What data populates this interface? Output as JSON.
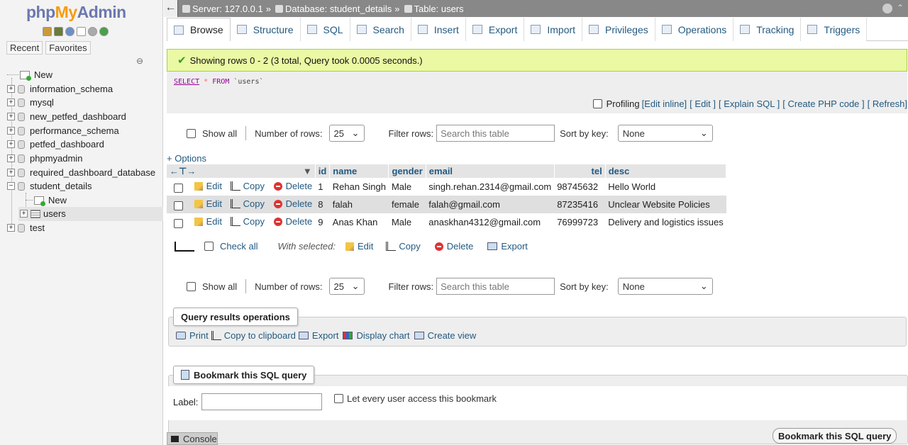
{
  "sidebar": {
    "logo_php": "php",
    "logo_my": "My",
    "logo_admin": "Admin",
    "tabs": [
      "Recent",
      "Favorites"
    ],
    "tree": {
      "new_label": "New",
      "databases": [
        {
          "name": "information_schema"
        },
        {
          "name": "mysql"
        },
        {
          "name": "new_petfed_dashboard"
        },
        {
          "name": "performance_schema"
        },
        {
          "name": "petfed_dashboard"
        },
        {
          "name": "phpmyadmin"
        },
        {
          "name": "required_dashboard_database"
        },
        {
          "name": "student_details"
        },
        {
          "name": "test"
        }
      ],
      "child_new": "New",
      "child_table": "users"
    }
  },
  "breadcrumb": {
    "server": "Server: 127.0.0.1",
    "database": "Database: student_details",
    "table": "Table: users",
    "sep": "»"
  },
  "tabs": [
    "Browse",
    "Structure",
    "SQL",
    "Search",
    "Insert",
    "Export",
    "Import",
    "Privileges",
    "Operations",
    "Tracking",
    "Triggers"
  ],
  "message": "Showing rows 0 - 2 (3 total, Query took 0.0005 seconds.)",
  "sql": {
    "select": "SELECT",
    "star": "*",
    "from": "FROM",
    "table": "`users`"
  },
  "profiling": {
    "label": "Profiling",
    "edit_inline": "[Edit inline]",
    "edit": "[ Edit ]",
    "explain": "[ Explain SQL ]",
    "php": "[ Create PHP code ]",
    "refresh": "[ Refresh]"
  },
  "nav": {
    "show_all": "Show all",
    "num_rows_label": "Number of rows:",
    "num_rows_value": "25",
    "filter_label": "Filter rows:",
    "filter_placeholder": "Search this table",
    "sort_label": "Sort by key:",
    "sort_value": "None"
  },
  "options_link": "+ Options",
  "table": {
    "columns": [
      "id",
      "name",
      "gender",
      "email",
      "tel",
      "desc"
    ],
    "actions": {
      "edit": "Edit",
      "copy": "Copy",
      "delete": "Delete"
    },
    "rows": [
      {
        "id": "1",
        "name": "Rehan Singh",
        "gender": "Male",
        "email": "singh.rehan.2314@gmail.com",
        "tel": "98745632",
        "desc": "Hello World"
      },
      {
        "id": "8",
        "name": "falah",
        "gender": "female",
        "email": "falah@gmail.com",
        "tel": "87235416",
        "desc": "Unclear Website Policies"
      },
      {
        "id": "9",
        "name": "Anas Khan",
        "gender": "Male",
        "email": "anaskhan4312@gmail.com",
        "tel": "76999723",
        "desc": "Delivery and logistics issues"
      }
    ]
  },
  "with_selected": {
    "check_all": "Check all",
    "label": "With selected:",
    "edit": "Edit",
    "copy": "Copy",
    "delete": "Delete",
    "export": "Export"
  },
  "qro": {
    "title": "Query results operations",
    "print": "Print",
    "copy_clipboard": "Copy to clipboard",
    "export": "Export",
    "display_chart": "Display chart",
    "create_view": "Create view"
  },
  "bookmark": {
    "title": "Bookmark this SQL query",
    "label": "Label:",
    "every_user": "Let every user access this bookmark",
    "button": "Bookmark this SQL query"
  },
  "console": "Console"
}
